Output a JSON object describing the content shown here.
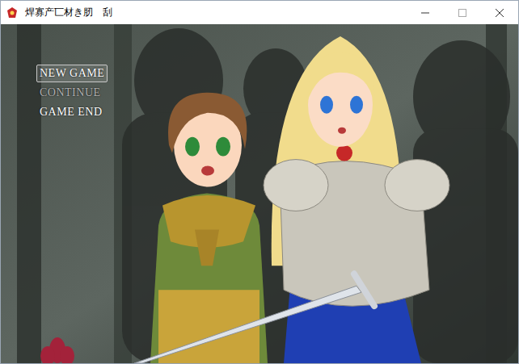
{
  "window": {
    "title": "焊寡产匸材き肕　刮"
  },
  "menu": [
    {
      "label": "NEW GAME",
      "selected": true,
      "disabled": false
    },
    {
      "label": "CONTINUE",
      "selected": false,
      "disabled": true
    },
    {
      "label": "GAME END",
      "selected": false,
      "disabled": false
    }
  ]
}
